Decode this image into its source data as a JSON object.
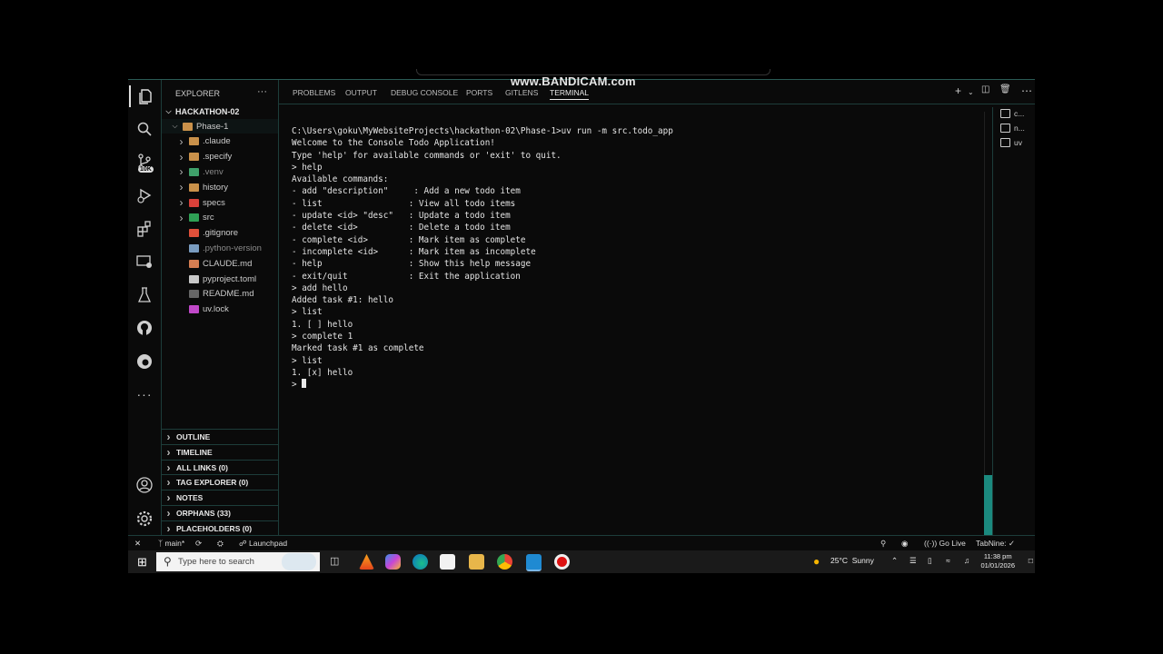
{
  "watermark": "www.BANDICAM.com",
  "sidebar": {
    "title": "EXPLORER",
    "more": "···",
    "workspace": "HACKATHON-02",
    "tree": [
      {
        "label": "Phase-1",
        "depth": 1,
        "chevron": "v",
        "icon": "folder"
      },
      {
        "label": ".claude",
        "depth": 2,
        "chevron": ">",
        "icon": "folder"
      },
      {
        "label": ".specify",
        "depth": 2,
        "chevron": ">",
        "icon": "folder"
      },
      {
        "label": ".venv",
        "depth": 2,
        "chevron": ">",
        "icon": "folder-venv"
      },
      {
        "label": "history",
        "depth": 2,
        "chevron": ">",
        "icon": "folder"
      },
      {
        "label": "specs",
        "depth": 2,
        "chevron": ">",
        "icon": "folder-red"
      },
      {
        "label": "src",
        "depth": 2,
        "chevron": ">",
        "icon": "folder-green"
      },
      {
        "label": ".gitignore",
        "depth": 2,
        "chevron": "",
        "icon": "git"
      },
      {
        "label": ".python-version",
        "depth": 2,
        "chevron": "",
        "icon": "python"
      },
      {
        "label": "CLAUDE.md",
        "depth": 2,
        "chevron": "",
        "icon": "claude"
      },
      {
        "label": "pyproject.toml",
        "depth": 2,
        "chevron": "",
        "icon": "file"
      },
      {
        "label": "README.md",
        "depth": 2,
        "chevron": "",
        "icon": "markdown"
      },
      {
        "label": "uv.lock",
        "depth": 2,
        "chevron": "",
        "icon": "lock"
      }
    ],
    "sections": [
      "OUTLINE",
      "TIMELINE",
      "ALL LINKS (0)",
      "TAG EXPLORER (0)",
      "NOTES",
      "ORPHANS (33)",
      "PLACEHOLDERS (0)"
    ]
  },
  "panel": {
    "tabs": [
      "PROBLEMS",
      "OUTPUT",
      "DEBUG CONSOLE",
      "PORTS",
      "GITLENS",
      "TERMINAL"
    ],
    "active_tab": "TERMINAL",
    "terminal_list": [
      "c...",
      "n...",
      "uv"
    ]
  },
  "terminal": {
    "lines": [
      "C:\\Users\\goku\\MyWebsiteProjects\\hackathon-02\\Phase-1>uv run -m src.todo_app",
      "Welcome to the Console Todo Application!",
      "Type 'help' for available commands or 'exit' to quit.",
      "> help",
      "Available commands:",
      "- add \"description\"     : Add a new todo item",
      "- list                 : View all todo items",
      "- update <id> \"desc\"   : Update a todo item",
      "- delete <id>          : Delete a todo item",
      "- complete <id>        : Mark item as complete",
      "- incomplete <id>      : Mark item as incomplete",
      "- help                 : Show this help message",
      "- exit/quit            : Exit the application",
      "> add hello",
      "Added task #1: hello",
      "> list",
      "1. [ ] hello",
      "> complete 1",
      "Marked task #1 as complete",
      "> list",
      "1. [x] hello"
    ],
    "prompt": "> "
  },
  "statusbar": {
    "branch": "main*",
    "launchpad": "Launchpad",
    "go_live": "Go Live",
    "tabnine": "TabNine: ✓"
  },
  "taskbar": {
    "search_placeholder": "Type here to search",
    "weather_temp": "25°C",
    "weather_desc": "Sunny",
    "time": "11:38 pm",
    "date": "01/01/2026"
  },
  "colors": {
    "accent": "#1b8a7f",
    "border": "#1d3d3a",
    "background": "#0a0a0a"
  }
}
